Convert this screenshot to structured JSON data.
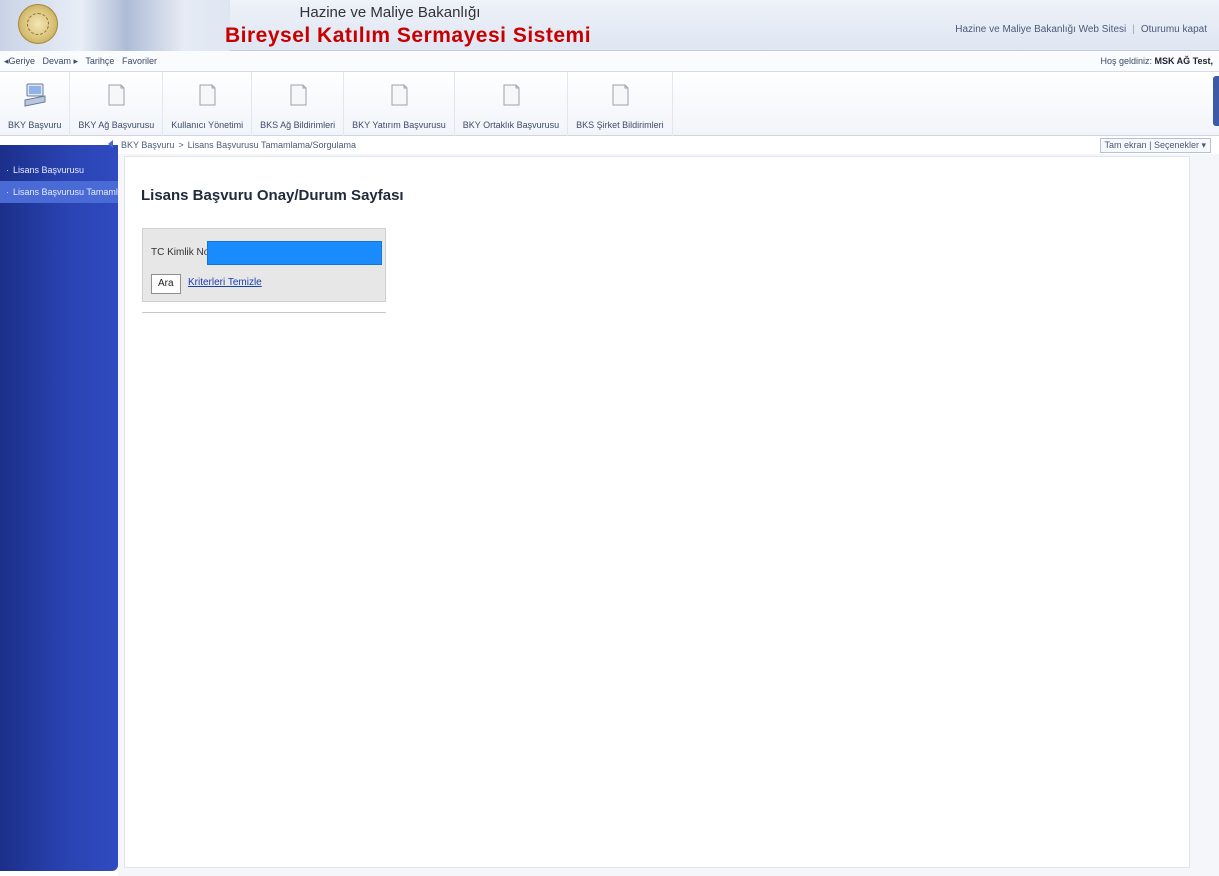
{
  "header": {
    "ministry": "Hazine ve Maliye Bakanlığı",
    "system_title": "Bireysel Katılım Sermayesi Sistemi",
    "links": [
      "Hazine ve Maliye Bakanlığı Web Sitesi",
      "Oturumu kapat"
    ]
  },
  "navbar": {
    "back": "◂Geriye",
    "forward": "Devam ▸",
    "history": "Tarihçe",
    "favorites": "Favoriler",
    "welcome_prefix": "Hoş geldiniz: ",
    "welcome_user": "MSK AĞ Test,"
  },
  "toolbar": {
    "items": [
      {
        "label": "BKY Başvuru",
        "icon": "computer-icon"
      },
      {
        "label": "BKY Ağ Başvurusu",
        "icon": "document-icon"
      },
      {
        "label": "Kullanıcı Yönetimi",
        "icon": "document-icon"
      },
      {
        "label": "BKS Ağ Bildirimleri",
        "icon": "document-icon"
      },
      {
        "label": "BKY Yatırım Başvurusu",
        "icon": "document-icon"
      },
      {
        "label": "BKY Ortaklık Başvurusu",
        "icon": "document-icon"
      },
      {
        "label": "BKS Şirket Bildirimleri",
        "icon": "document-icon"
      }
    ]
  },
  "sidebar": {
    "items": [
      {
        "label": "Lisans Başvurusu"
      },
      {
        "label": "Lisans Başvurusu Tamamlama"
      }
    ]
  },
  "breadcrumb": {
    "root": "BKY Başvuru",
    "separator": ">",
    "current": "Lisans Başvurusu Tamamlama/Sorgulama"
  },
  "options": {
    "fullscreen": "Tam ekran",
    "separator": "|",
    "settings": "Seçenekler ▾"
  },
  "page": {
    "title": "Lisans Başvuru Onay/Durum Sayfası",
    "tc_label": "TC Kimlik No",
    "tc_value": "",
    "search_button": "Ara",
    "clear_link": "Kriterleri Temizle"
  },
  "colors": {
    "title_red": "#c80000",
    "sidebar_blue": "#2a44b4",
    "input_highlight": "#1a8cff",
    "link_blue": "#1a3fb0"
  }
}
